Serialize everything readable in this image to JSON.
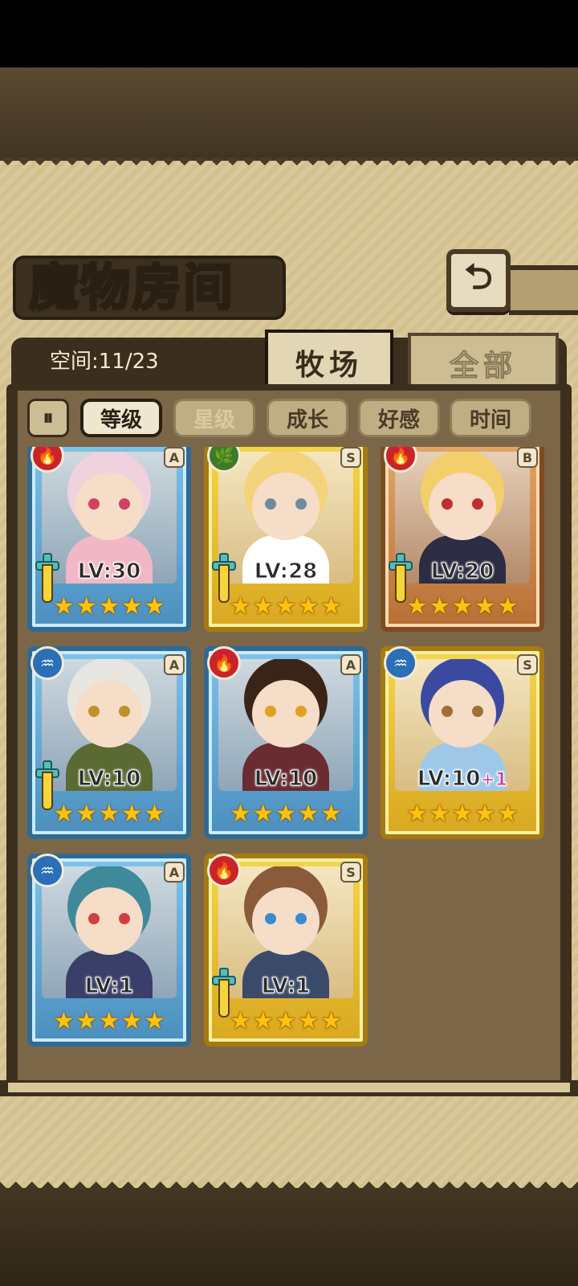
{
  "header": {
    "title": "魔物房间",
    "back_icon": "return-arrow-icon",
    "back_glyph": "⮌"
  },
  "tabs": {
    "space_label": "空间:11/23",
    "active": "牧场",
    "other": "全部"
  },
  "sort": {
    "pause_glyph": "⏸",
    "buttons": [
      {
        "label": "等级",
        "state": "on"
      },
      {
        "label": "星级",
        "state": "dim"
      },
      {
        "label": "成长",
        "state": "off"
      },
      {
        "label": "好感",
        "state": "off"
      },
      {
        "label": "时间",
        "state": "off"
      }
    ]
  },
  "cards": [
    {
      "element": "fire",
      "rank": "A",
      "frame": "blue",
      "level": "LV:30",
      "plus": "",
      "stars": 5,
      "weapon": true,
      "hair": "#f0d2dc",
      "cloth": "#f2b7c5",
      "eye": "#d04060"
    },
    {
      "element": "leaf",
      "rank": "S",
      "frame": "gold",
      "level": "LV:28",
      "plus": "",
      "stars": 5,
      "weapon": true,
      "hair": "#f3d37c",
      "cloth": "#ffffff",
      "eye": "#6f8aa0"
    },
    {
      "element": "fire",
      "rank": "B",
      "frame": "bronze",
      "level": "LV:20",
      "plus": "",
      "stars": 5,
      "weapon": true,
      "hair": "#f2cf6a",
      "cloth": "#2c2c44",
      "eye": "#c03030"
    },
    {
      "element": "water",
      "rank": "A",
      "frame": "blue",
      "level": "LV:10",
      "plus": "",
      "stars": 5,
      "weapon": true,
      "hair": "#e8e6e0",
      "cloth": "#5a6a32",
      "eye": "#c0902a"
    },
    {
      "element": "fire",
      "rank": "A",
      "frame": "blue",
      "level": "LV:10",
      "plus": "",
      "stars": 5,
      "weapon": false,
      "hair": "#3a2418",
      "cloth": "#6a2c30",
      "eye": "#e0a020"
    },
    {
      "element": "water",
      "rank": "S",
      "frame": "gold",
      "level": "LV:10",
      "plus": "+1",
      "stars": 5,
      "weapon": false,
      "hair": "#3a4aa0",
      "cloth": "#9fc8e8",
      "eye": "#a07030"
    },
    {
      "element": "water",
      "rank": "A",
      "frame": "blue",
      "level": "LV:1",
      "plus": "",
      "stars": 5,
      "weapon": false,
      "hair": "#3f8a9a",
      "cloth": "#3a3f6a",
      "eye": "#d04040"
    },
    {
      "element": "fire",
      "rank": "S",
      "frame": "gold",
      "level": "LV:1",
      "plus": "",
      "stars": 5,
      "weapon": true,
      "hair": "#8a5a3a",
      "cloth": "#3a4a6a",
      "eye": "#3a8ad0"
    }
  ],
  "element_glyphs": {
    "fire": "🔥",
    "leaf": "🌿",
    "water": "♒"
  },
  "star_glyph": "★"
}
